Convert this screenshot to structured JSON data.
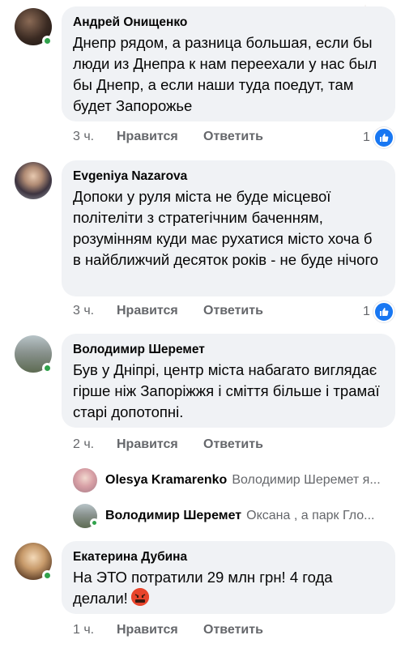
{
  "comments": [
    {
      "author": "Андрей Онищенко",
      "text": "Днепр рядом, а разница большая, если бы люди из Днепра к нам переехали у нас был бы Днепр, а если наши туда поедут, там будет Запорожье",
      "time": "3 ч.",
      "like_label": "Нравится",
      "reply_label": "Ответить",
      "reaction_count": "1"
    },
    {
      "author": "Evgeniya Nazarova",
      "text": "Допоки у руля міста не буде місцевої політеліти з стратегічним баченням, розумінням куди має рухатися місто хоча б в найближчий десяток років - не буде нічого",
      "time": "3 ч.",
      "like_label": "Нравится",
      "reply_label": "Ответить",
      "reaction_count": "1"
    },
    {
      "author": "Володимир Шеремет",
      "text": "Був у Дніпрі, центр міста набагато виглядає гірше ніж Запоріжжя і сміття більше і трамаї старі допотопні.",
      "time": "2 ч.",
      "like_label": "Нравится",
      "reply_label": "Ответить"
    },
    {
      "author": "Екатерина Дубина",
      "text": "На ЭТО потратили 29 млн грн! 4 года делали!",
      "time": "1 ч.",
      "like_label": "Нравится",
      "reply_label": "Ответить"
    }
  ],
  "replies": [
    {
      "author": "Olesya Kramarenko",
      "preview": "Володимир Шеремет я..."
    },
    {
      "author": "Володимир Шеремет",
      "preview": "Оксана , а парк Гло..."
    }
  ],
  "colors": {
    "bubble": "#f0f2f5",
    "meta": "#65676b",
    "online": "#31a24c",
    "like": "#1877f2"
  },
  "icons": {
    "like": "thumbs-up-icon",
    "emoji": "angry-face-emoji-icon"
  }
}
